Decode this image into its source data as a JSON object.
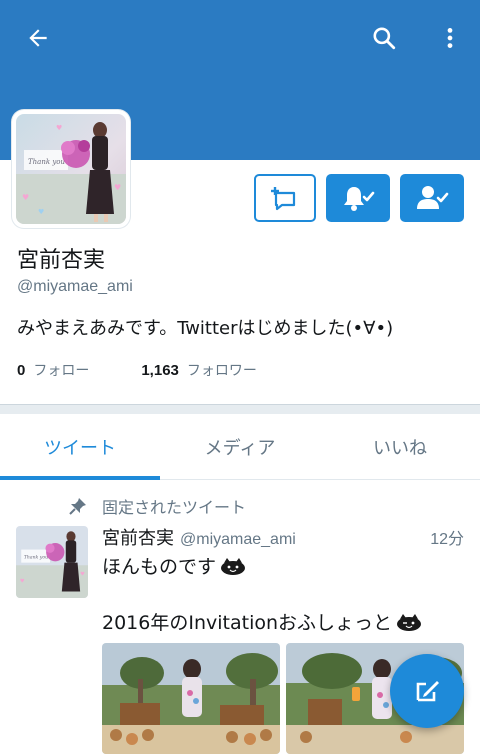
{
  "colors": {
    "banner": "#2b7bc2",
    "accent": "#1e8ad9",
    "text_primary": "#14171a",
    "text_secondary": "#657786"
  },
  "topbar": {
    "back_icon": "arrow-left-icon",
    "search_icon": "search-icon",
    "more_icon": "more-vertical-icon"
  },
  "profile": {
    "name": "宮前杏実",
    "handle": "@miyamae_ami",
    "bio": "みやまえあみです。Twitterはじめました(•∀•)",
    "following_count": "0",
    "following_label": "フォロー",
    "followers_count": "1,163",
    "followers_label": "フォロワー"
  },
  "actions": {
    "dm_icon": "message-add-icon",
    "notify_icon": "bell-check-icon",
    "following_icon": "person-check-icon"
  },
  "tabs": [
    {
      "label": "ツイート",
      "active": true
    },
    {
      "label": "メディア",
      "active": false
    },
    {
      "label": "いいね",
      "active": false
    }
  ],
  "pinned": {
    "label": "固定されたツイート",
    "icon": "pin-icon"
  },
  "tweet": {
    "name": "宮前杏実",
    "handle": "@miyamae_ami",
    "time": "12分",
    "line1": "ほんものです",
    "line2": "2016年のInvitationおふしょっと"
  },
  "fab": {
    "icon": "compose-icon"
  }
}
